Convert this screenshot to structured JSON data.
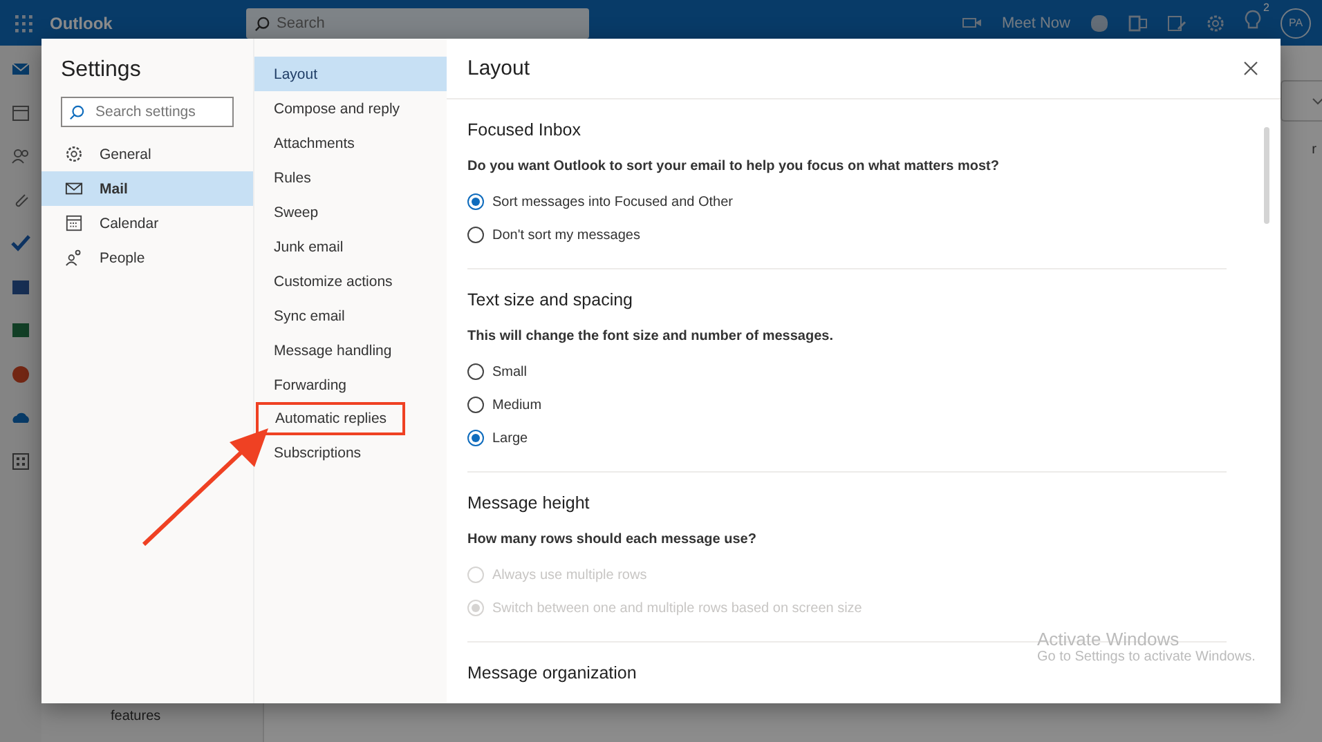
{
  "top_bar": {
    "app_name": "Outlook",
    "search": {
      "placeholder": "Search"
    },
    "meet_now": "Meet Now",
    "notification_badge": "2",
    "avatar": "PA"
  },
  "background": {
    "promo_text": "features",
    "column_text": "r"
  },
  "settings": {
    "title": "Settings",
    "search": {
      "placeholder": "Search settings"
    },
    "categories": [
      {
        "label": "General",
        "selected": false
      },
      {
        "label": "Mail",
        "selected": true
      },
      {
        "label": "Calendar",
        "selected": false
      },
      {
        "label": "People",
        "selected": false
      }
    ],
    "mail_items": [
      {
        "label": "Layout",
        "selected": true,
        "highlighted": false
      },
      {
        "label": "Compose and reply",
        "selected": false,
        "highlighted": false
      },
      {
        "label": "Attachments",
        "selected": false,
        "highlighted": false
      },
      {
        "label": "Rules",
        "selected": false,
        "highlighted": false
      },
      {
        "label": "Sweep",
        "selected": false,
        "highlighted": false
      },
      {
        "label": "Junk email",
        "selected": false,
        "highlighted": false
      },
      {
        "label": "Customize actions",
        "selected": false,
        "highlighted": false
      },
      {
        "label": "Sync email",
        "selected": false,
        "highlighted": false
      },
      {
        "label": "Message handling",
        "selected": false,
        "highlighted": false
      },
      {
        "label": "Forwarding",
        "selected": false,
        "highlighted": false
      },
      {
        "label": "Automatic replies",
        "selected": false,
        "highlighted": true
      },
      {
        "label": "Subscriptions",
        "selected": false,
        "highlighted": false
      }
    ],
    "pane": {
      "title": "Layout",
      "sections": [
        {
          "title": "Focused Inbox",
          "question": "Do you want Outlook to sort your email to help you focus on what matters most?",
          "options": [
            {
              "label": "Sort messages into Focused and Other",
              "selected": true,
              "disabled": false
            },
            {
              "label": "Don't sort my messages",
              "selected": false,
              "disabled": false
            }
          ]
        },
        {
          "title": "Text size and spacing",
          "question": "This will change the font size and number of messages.",
          "options": [
            {
              "label": "Small",
              "selected": false,
              "disabled": false
            },
            {
              "label": "Medium",
              "selected": false,
              "disabled": false
            },
            {
              "label": "Large",
              "selected": true,
              "disabled": false
            }
          ]
        },
        {
          "title": "Message height",
          "question": "How many rows should each message use?",
          "options": [
            {
              "label": "Always use multiple rows",
              "selected": false,
              "disabled": true
            },
            {
              "label": "Switch between one and multiple rows based on screen size",
              "selected": true,
              "disabled": true
            }
          ]
        },
        {
          "title": "Message organization"
        }
      ]
    }
  },
  "os_notice": {
    "title": "Activate Windows",
    "subtitle": "Go to Settings to activate Windows."
  }
}
